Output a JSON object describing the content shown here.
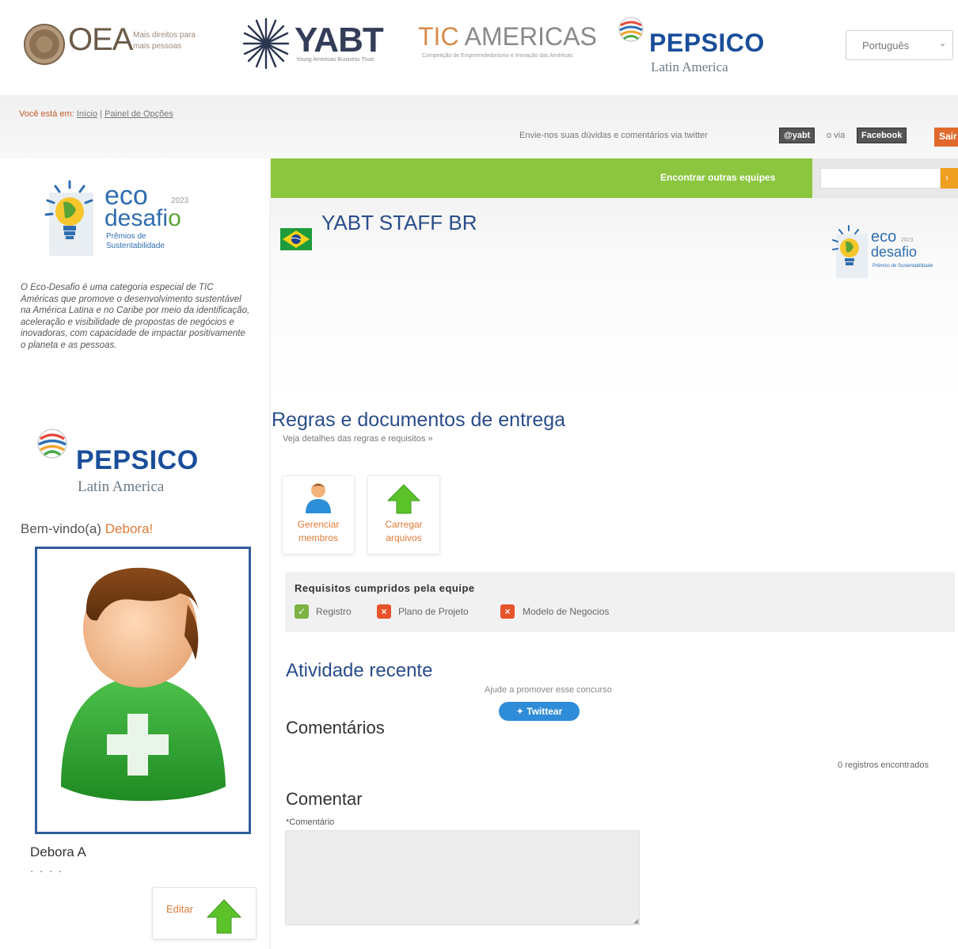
{
  "header": {
    "oea": {
      "name": "OEA",
      "subtitle": "Mais direitos para mais pessoas"
    },
    "yabt": {
      "name": "YABT",
      "subtitle": "Young Americas Business Trust"
    },
    "tic": {
      "prefix": "TIC",
      "suffix": " AMERICAS",
      "subtitle": "Competição de Empreendedorismo e Inovação das Américas"
    },
    "pepsico": {
      "name": "PEPSICO",
      "region": "Latin America"
    },
    "language": {
      "selected": "Português",
      "caret": "⌄"
    }
  },
  "breadcrumb": {
    "prefix": "Você está em:",
    "items": [
      "Início",
      "Painel de Opções"
    ],
    "separator": "|"
  },
  "social": {
    "text": "Envie-nos suas dúvidas e comentários via twitter",
    "twitter_label": "@yabt",
    "or_text": "o via",
    "facebook_label": "Facebook",
    "logout_label": "Sair"
  },
  "search": {
    "label": "Encontrar outras equipes",
    "placeholder": "",
    "button_icon": "›"
  },
  "sidebar": {
    "eco_logo": {
      "eco": "eco",
      "year": "2023",
      "desafi": "desafi",
      "o": "o",
      "subtitle": "Prêmios de Sustentabilidade"
    },
    "description": "O Eco-Desafio é uma categoria especial de TIC Américas que promove o desenvolvimento sustentável na América Latina e no Caribe por meio da identificação, aceleração e visibilidade de propostas de negócios e inovadoras, com capacidade de impactar positivamente o planeta e as pessoas.",
    "sponsor": {
      "name": "PEPSICO",
      "region": "Latin America"
    },
    "welcome_prefix": "Bem-vindo(a)",
    "welcome_name": "Debora!",
    "user_full_name": "Debora A",
    "user_dots": "· · · ·",
    "edit_label": "Editar"
  },
  "team": {
    "name": "YABT STAFF BR",
    "eco_small": {
      "eco": "eco",
      "year": "2023",
      "desafio": "desafio",
      "subtitle": "Prêmios de Sustentabilidade"
    }
  },
  "rules": {
    "title": "Regras e documentos de entrega",
    "link": "Veja detalhes das regras e requisitos »"
  },
  "actions": [
    {
      "label_1": "Gerenciar",
      "label_2": "membros",
      "icon": "person-icon"
    },
    {
      "label_1": "Carregar",
      "label_2": "arquivos",
      "icon": "upload-arrow-icon"
    }
  ],
  "requirements": {
    "title": "Requisitos cumpridos pela equipe",
    "items": [
      {
        "label": "Registro",
        "status": "done",
        "symbol": "✓",
        "color": "#7cb342"
      },
      {
        "label": "Plano de Projeto",
        "status": "pending",
        "symbol": "×",
        "color": "#e8542a"
      },
      {
        "label": "Modelo de Negocios",
        "status": "pending",
        "symbol": "×",
        "color": "#e8542a"
      }
    ]
  },
  "activity": {
    "title": "Atividade recente",
    "promote": "Ajude a promover esse concurso",
    "tweet_label": "Twittear"
  },
  "comments": {
    "title": "Comentários",
    "records": "0 registros encontrados",
    "form_title": "Comentar",
    "field_label": "*Comentário"
  },
  "colors": {
    "green_bar": "#8cc63f",
    "title_blue": "#2a4d8a",
    "accent_orange": "#e07b39",
    "frame_blue": "#2f5d9c"
  }
}
